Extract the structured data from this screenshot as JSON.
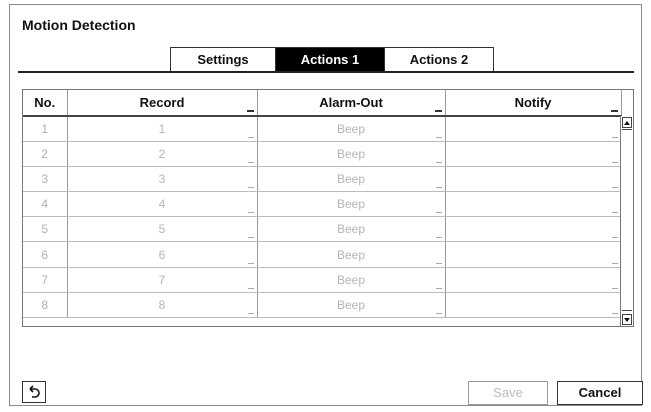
{
  "dialog": {
    "title": "Motion Detection"
  },
  "tabs": [
    {
      "label": "Settings",
      "active": false
    },
    {
      "label": "Actions 1",
      "active": true
    },
    {
      "label": "Actions 2",
      "active": false
    }
  ],
  "table": {
    "headers": {
      "no": "No.",
      "record": "Record",
      "alarm_out": "Alarm-Out",
      "notify": "Notify"
    },
    "rows": [
      {
        "no": "1",
        "record": "1",
        "alarm_out": "Beep",
        "notify": ""
      },
      {
        "no": "2",
        "record": "2",
        "alarm_out": "Beep",
        "notify": ""
      },
      {
        "no": "3",
        "record": "3",
        "alarm_out": "Beep",
        "notify": ""
      },
      {
        "no": "4",
        "record": "4",
        "alarm_out": "Beep",
        "notify": ""
      },
      {
        "no": "5",
        "record": "5",
        "alarm_out": "Beep",
        "notify": ""
      },
      {
        "no": "6",
        "record": "6",
        "alarm_out": "Beep",
        "notify": ""
      },
      {
        "no": "7",
        "record": "7",
        "alarm_out": "Beep",
        "notify": ""
      },
      {
        "no": "8",
        "record": "8",
        "alarm_out": "Beep",
        "notify": ""
      }
    ]
  },
  "footer": {
    "save_label": "Save",
    "cancel_label": "Cancel",
    "back_icon": "back-arrow-icon"
  },
  "colors": {
    "active_tab_bg": "#000000",
    "disabled_text": "#b5b5b5"
  }
}
